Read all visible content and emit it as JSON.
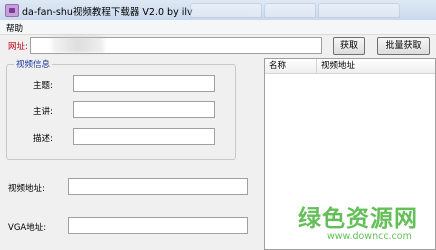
{
  "window": {
    "title": "da-fan-shu视频教程下载器 V2.0 by ilv"
  },
  "menu": {
    "help": "帮助"
  },
  "url_row": {
    "label": "网址:",
    "value": "",
    "fetch_button": "获取",
    "batch_button": "批量获取"
  },
  "video_info": {
    "group_title": "视频信息",
    "subject_label": "主题:",
    "subject_value": "",
    "speaker_label": "主讲:",
    "speaker_value": "",
    "description_label": "描述:",
    "description_value": ""
  },
  "video_address": {
    "label": "视频地址:",
    "value": ""
  },
  "vga_address": {
    "label": "VGA地址:",
    "value": ""
  },
  "list": {
    "columns": [
      "名称",
      "视频地址"
    ]
  },
  "watermark": {
    "text_zh": "绿色资源网",
    "text_en": "www.downcc.com"
  },
  "colors": {
    "url_label": "#c0001a",
    "group_title": "#1a3a9a",
    "watermark": "#54b948"
  }
}
